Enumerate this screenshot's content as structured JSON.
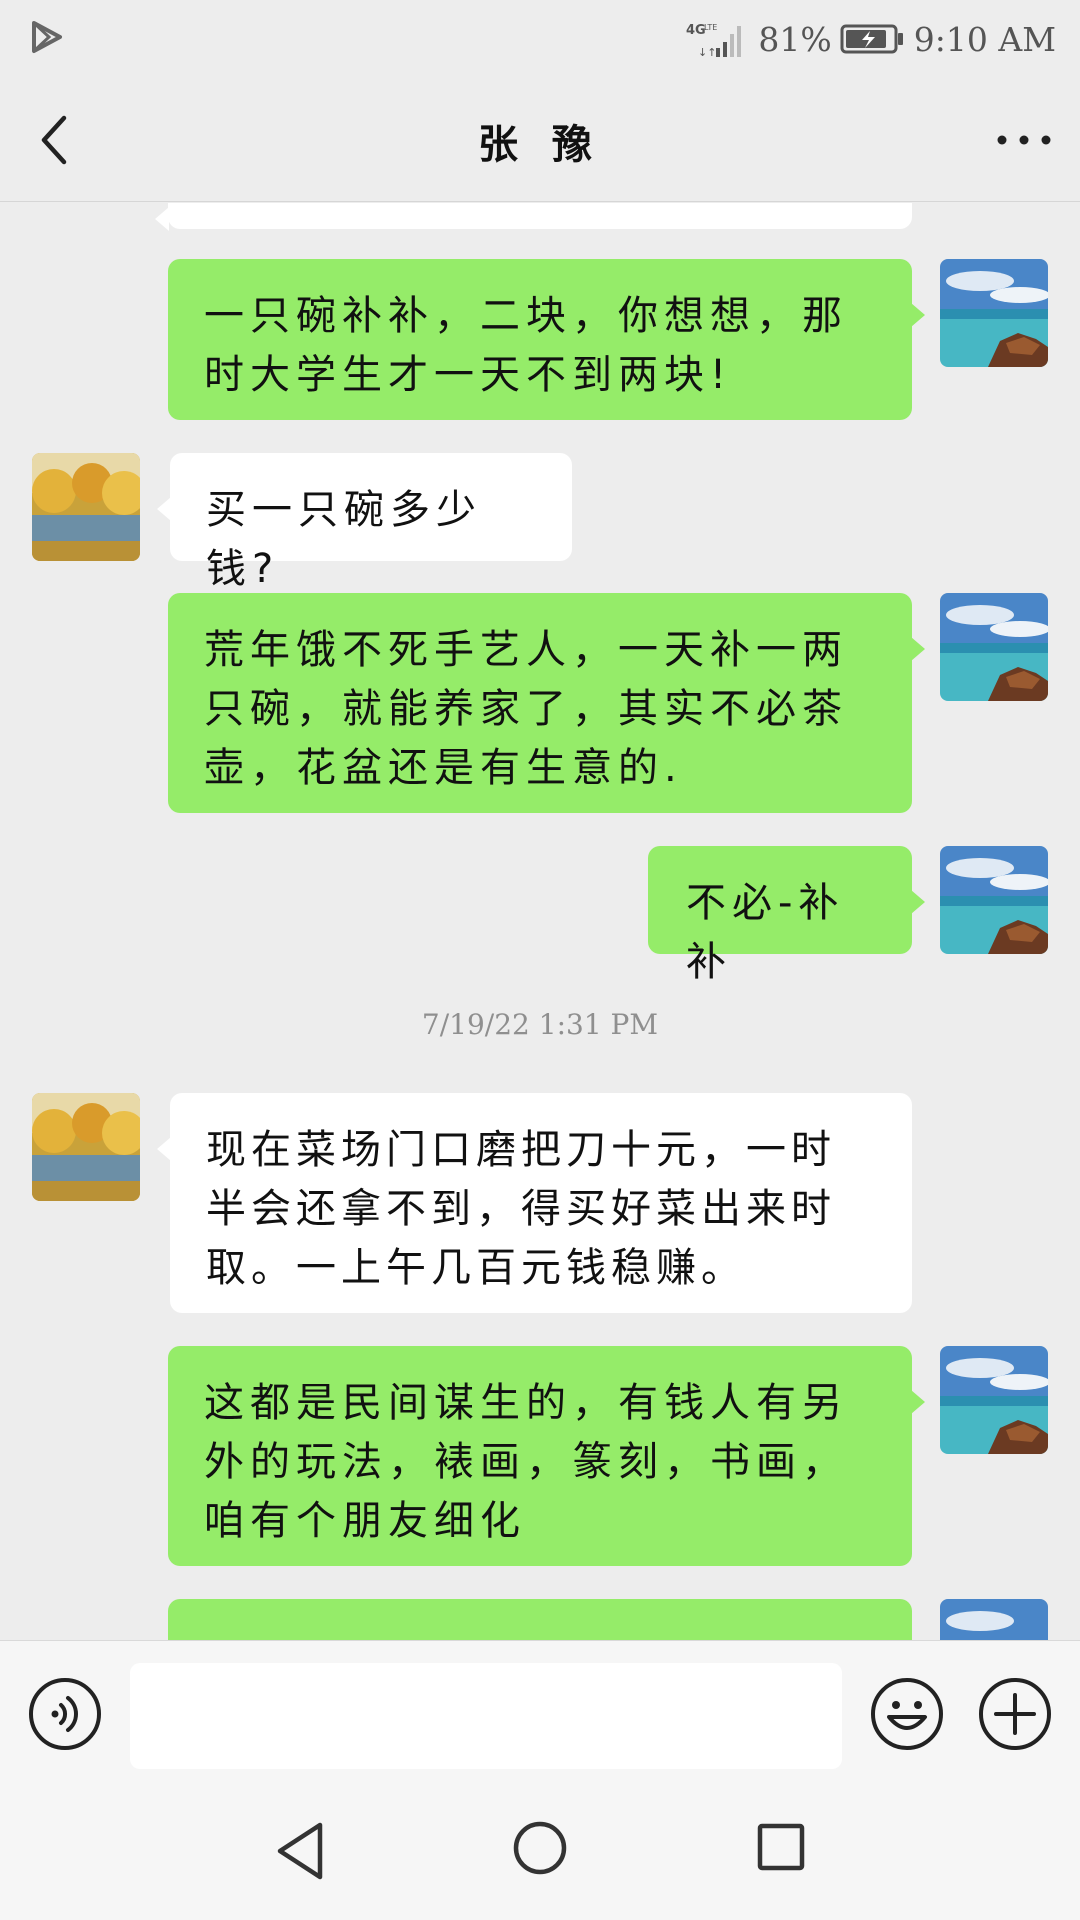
{
  "status_bar": {
    "network": "4G LTE",
    "battery": "81%",
    "time": "9:10 AM"
  },
  "header": {
    "title": "张 豫"
  },
  "messages": [
    {
      "from": "me",
      "text": "一只碗补补，二块，你想想，那时大学生才一天不到两块!"
    },
    {
      "from": "contact",
      "text": "买一只碗多少钱?"
    },
    {
      "from": "me",
      "text": "荒年饿不死手艺人，一天补一两只碗，就能养家了，其实不必茶壶，花盆还是有生意的."
    },
    {
      "from": "me",
      "text": "不必-补补"
    },
    {
      "from": "contact",
      "text": "现在菜场门口磨把刀十元，一时半会还拿不到，得买好菜出来时取。一上午几百元钱稳赚。"
    },
    {
      "from": "me",
      "text": "这都是民间谋生的，有钱人有另外的玩法，裱画，篆刻，书画，咱有个朋友细化"
    }
  ],
  "timestamp": "7/19/22 1:31 PM",
  "icons": {
    "back": "chevron-left-icon",
    "more": "more-dots-icon",
    "voice": "voice-icon",
    "emoji": "emoji-icon",
    "plus": "plus-icon"
  },
  "colors": {
    "outgoing_bubble": "#95ec69",
    "incoming_bubble": "#ffffff",
    "background": "#ededed"
  }
}
